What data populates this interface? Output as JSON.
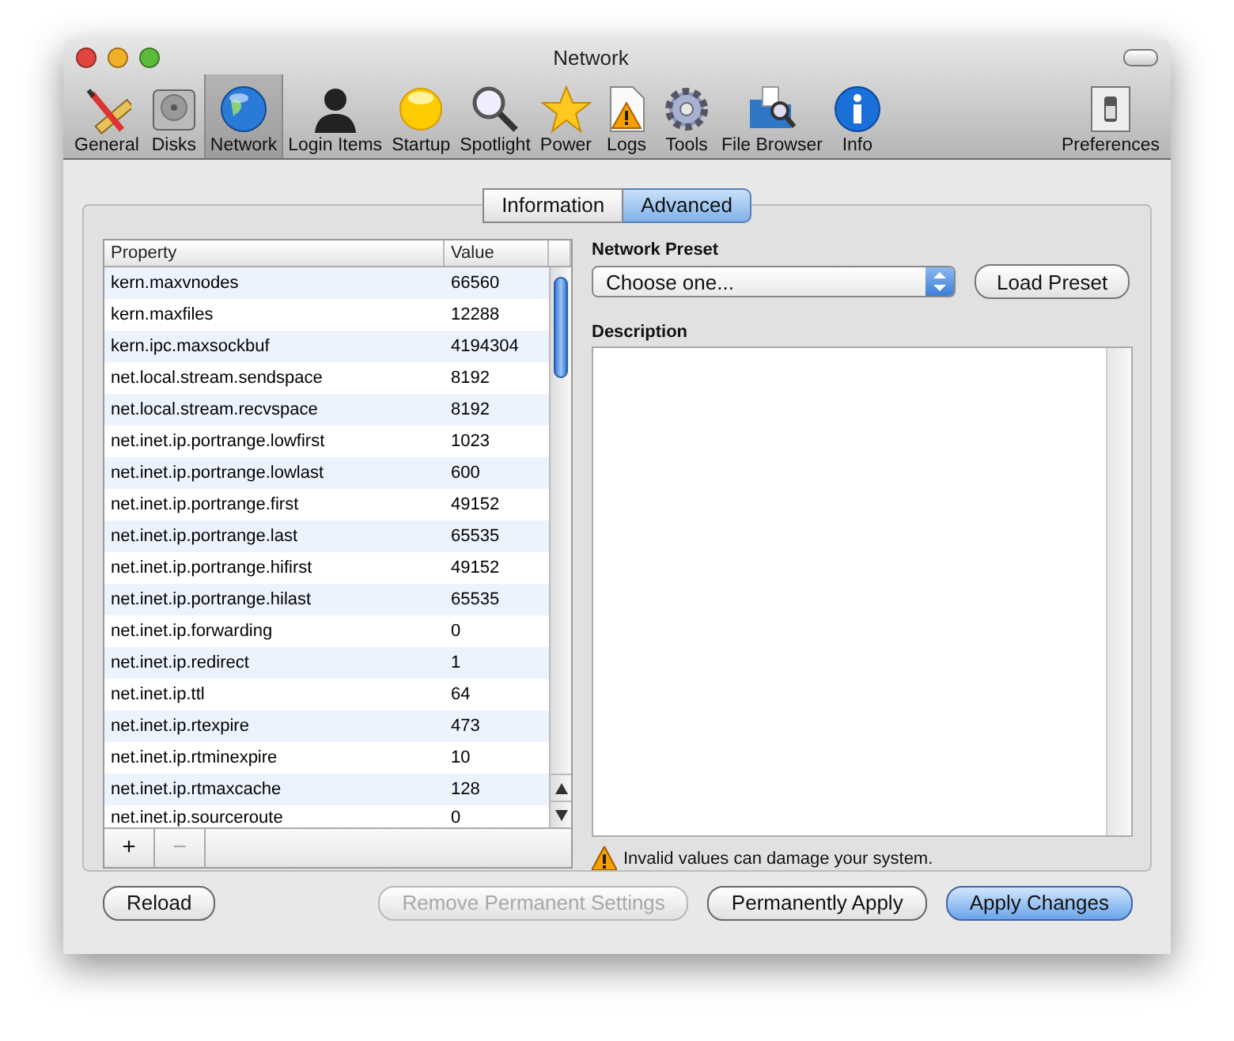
{
  "window": {
    "title": "Network"
  },
  "toolbar": [
    {
      "label": "General",
      "selected": false
    },
    {
      "label": "Disks",
      "selected": false
    },
    {
      "label": "Network",
      "selected": true
    },
    {
      "label": "Login Items",
      "selected": false
    },
    {
      "label": "Startup",
      "selected": false
    },
    {
      "label": "Spotlight",
      "selected": false
    },
    {
      "label": "Power",
      "selected": false
    },
    {
      "label": "Logs",
      "selected": false
    },
    {
      "label": "Tools",
      "selected": false
    },
    {
      "label": "File Browser",
      "selected": false
    },
    {
      "label": "Info",
      "selected": false
    }
  ],
  "preferences_button": {
    "label": "Preferences"
  },
  "tabs": [
    {
      "label": "Information",
      "selected": false
    },
    {
      "label": "Advanced",
      "selected": true
    }
  ],
  "table": {
    "columns": [
      "Property",
      "Value"
    ],
    "rows": [
      {
        "property": "kern.maxvnodes",
        "value": "66560"
      },
      {
        "property": "kern.maxfiles",
        "value": "12288"
      },
      {
        "property": "kern.ipc.maxsockbuf",
        "value": "4194304"
      },
      {
        "property": "net.local.stream.sendspace",
        "value": "8192"
      },
      {
        "property": "net.local.stream.recvspace",
        "value": "8192"
      },
      {
        "property": "net.inet.ip.portrange.lowfirst",
        "value": "1023"
      },
      {
        "property": "net.inet.ip.portrange.lowlast",
        "value": "600"
      },
      {
        "property": "net.inet.ip.portrange.first",
        "value": "49152"
      },
      {
        "property": "net.inet.ip.portrange.last",
        "value": "65535"
      },
      {
        "property": "net.inet.ip.portrange.hifirst",
        "value": "49152"
      },
      {
        "property": "net.inet.ip.portrange.hilast",
        "value": "65535"
      },
      {
        "property": "net.inet.ip.forwarding",
        "value": "0"
      },
      {
        "property": "net.inet.ip.redirect",
        "value": "1"
      },
      {
        "property": "net.inet.ip.ttl",
        "value": "64"
      },
      {
        "property": "net.inet.ip.rtexpire",
        "value": "473"
      },
      {
        "property": "net.inet.ip.rtminexpire",
        "value": "10"
      },
      {
        "property": "net.inet.ip.rtmaxcache",
        "value": "128"
      },
      {
        "property": "net.inet.ip.sourceroute",
        "value": "0"
      }
    ],
    "add_button": {
      "label": "+",
      "disabled": false
    },
    "remove_button": {
      "label": "−",
      "disabled": true
    }
  },
  "preset": {
    "label": "Network Preset",
    "popup_value": "Choose one...",
    "load_button": "Load Preset"
  },
  "description": {
    "label": "Description"
  },
  "warning": "Invalid values can damage your system.",
  "buttons": [
    {
      "label": "Reload",
      "disabled": false,
      "default": false
    },
    {
      "label": "Remove Permanent Settings",
      "disabled": true,
      "default": false
    },
    {
      "label": "Permanently Apply",
      "disabled": false,
      "default": false
    },
    {
      "label": "Apply Changes",
      "disabled": false,
      "default": true
    }
  ]
}
